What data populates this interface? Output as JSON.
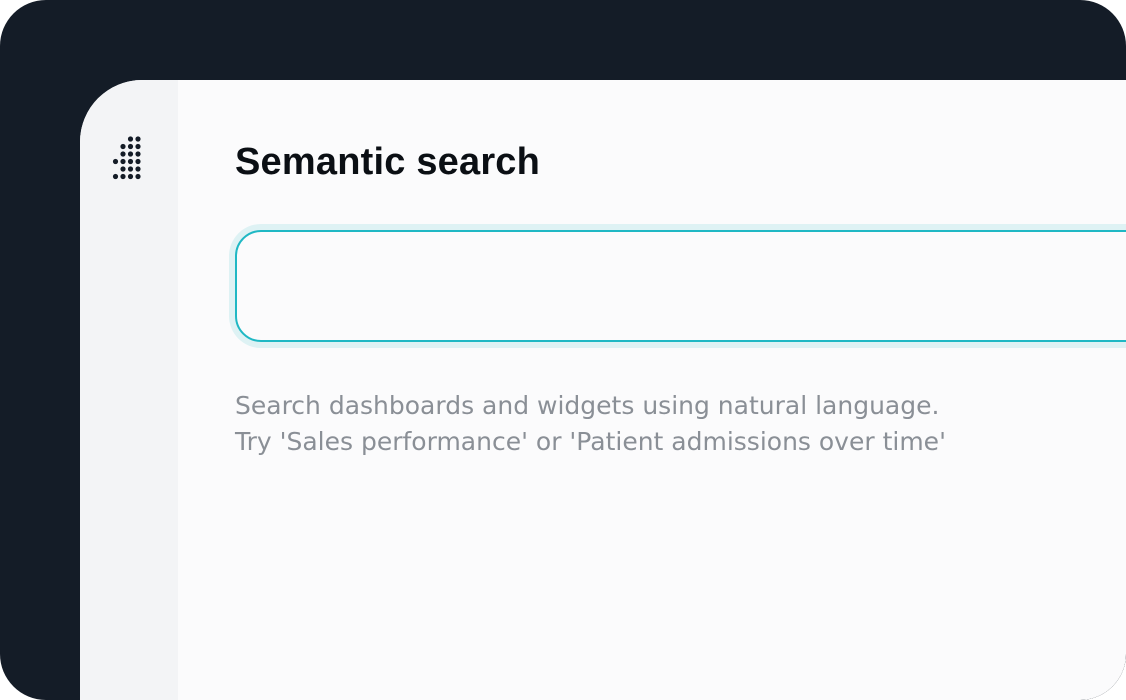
{
  "page": {
    "title": "Semantic search"
  },
  "sidebar": {
    "logo_icon": "dot-grid-logo-icon"
  },
  "search": {
    "value": "",
    "placeholder": ""
  },
  "hint": {
    "line1": "Search dashboards and widgets using natural language.",
    "line2": "Try 'Sales performance' or 'Patient admissions over time'"
  },
  "colors": {
    "outer_background": "#141c27",
    "window_background": "#fbfbfc",
    "sidebar_background": "#f3f4f6",
    "accent": "#1fb8c4",
    "title_text": "#0b0f14",
    "hint_text": "#8a8f96"
  }
}
